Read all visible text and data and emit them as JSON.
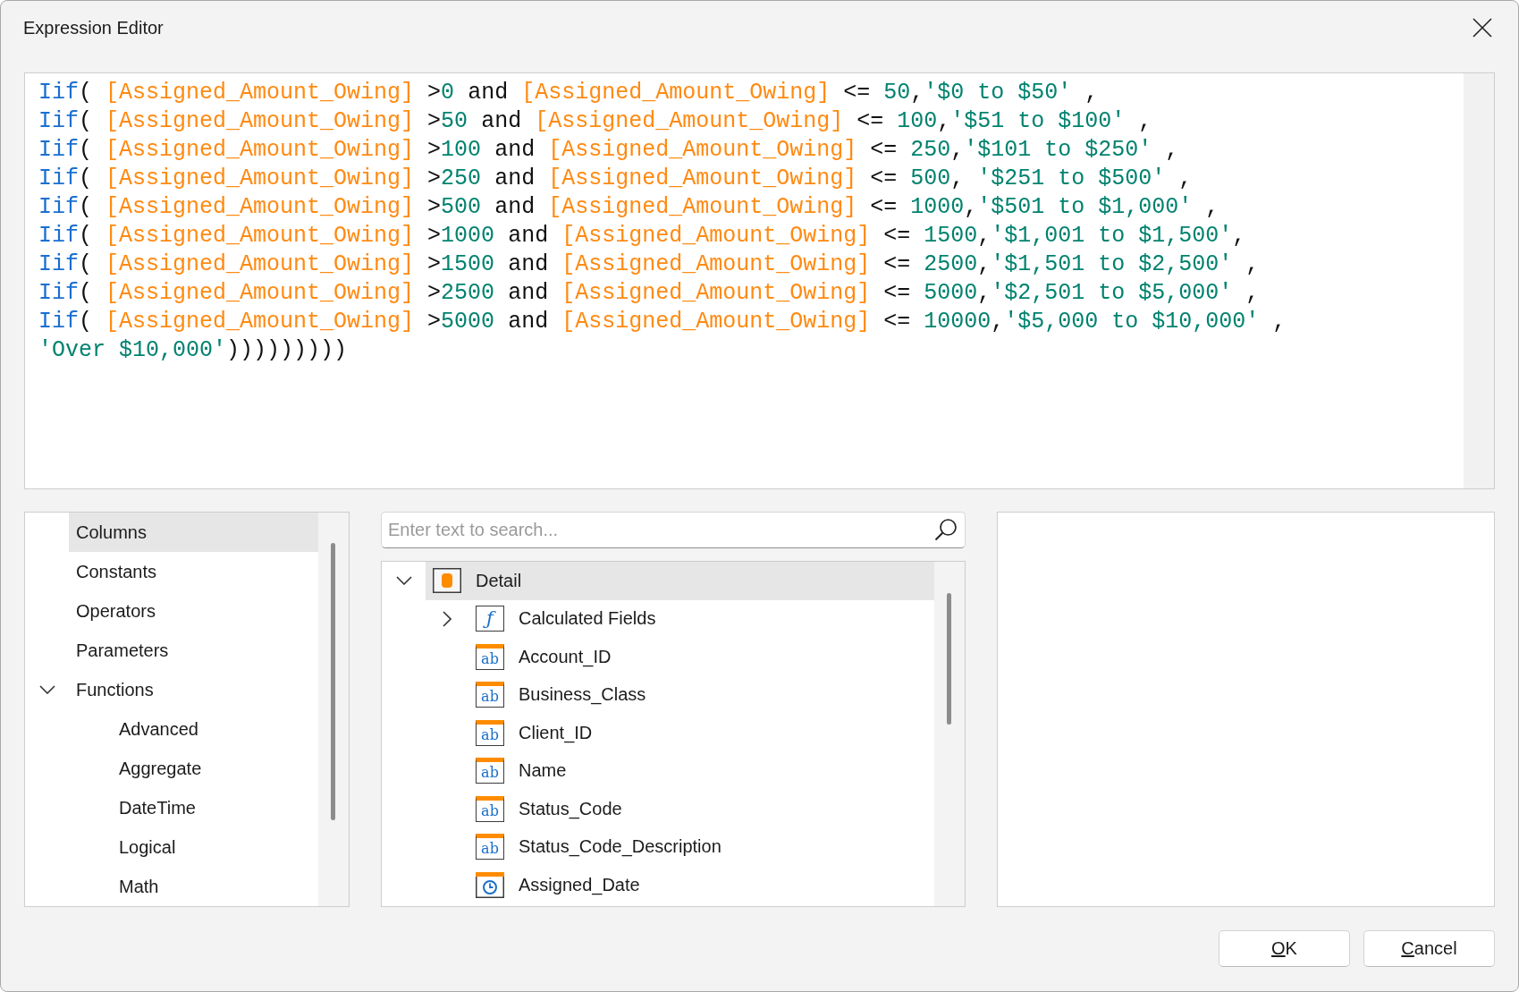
{
  "window": {
    "title": "Expression Editor"
  },
  "expression": {
    "lines": [
      {
        "tokens": [
          {
            "kind": "function",
            "text": "Iif"
          },
          {
            "kind": "plain",
            "text": "( "
          },
          {
            "kind": "field",
            "text": "[Assigned_Amount_Owing]"
          },
          {
            "kind": "plain",
            "text": " >"
          },
          {
            "kind": "number",
            "text": "0"
          },
          {
            "kind": "plain",
            "text": " and "
          },
          {
            "kind": "field",
            "text": "[Assigned_Amount_Owing]"
          },
          {
            "kind": "plain",
            "text": " <= "
          },
          {
            "kind": "number",
            "text": "50"
          },
          {
            "kind": "plain",
            "text": ","
          },
          {
            "kind": "string",
            "text": "'$0 to $50'"
          },
          {
            "kind": "plain",
            "text": " ,"
          }
        ]
      },
      {
        "tokens": [
          {
            "kind": "function",
            "text": "Iif"
          },
          {
            "kind": "plain",
            "text": "( "
          },
          {
            "kind": "field",
            "text": "[Assigned_Amount_Owing]"
          },
          {
            "kind": "plain",
            "text": " >"
          },
          {
            "kind": "number",
            "text": "50"
          },
          {
            "kind": "plain",
            "text": " and "
          },
          {
            "kind": "field",
            "text": "[Assigned_Amount_Owing]"
          },
          {
            "kind": "plain",
            "text": " <= "
          },
          {
            "kind": "number",
            "text": "100"
          },
          {
            "kind": "plain",
            "text": ","
          },
          {
            "kind": "string",
            "text": "'$51 to $100'"
          },
          {
            "kind": "plain",
            "text": " ,"
          }
        ]
      },
      {
        "tokens": [
          {
            "kind": "function",
            "text": "Iif"
          },
          {
            "kind": "plain",
            "text": "( "
          },
          {
            "kind": "field",
            "text": "[Assigned_Amount_Owing]"
          },
          {
            "kind": "plain",
            "text": " >"
          },
          {
            "kind": "number",
            "text": "100"
          },
          {
            "kind": "plain",
            "text": " and "
          },
          {
            "kind": "field",
            "text": "[Assigned_Amount_Owing]"
          },
          {
            "kind": "plain",
            "text": " <= "
          },
          {
            "kind": "number",
            "text": "250"
          },
          {
            "kind": "plain",
            "text": ","
          },
          {
            "kind": "string",
            "text": "'$101 to $250'"
          },
          {
            "kind": "plain",
            "text": " ,"
          }
        ]
      },
      {
        "tokens": [
          {
            "kind": "function",
            "text": "Iif"
          },
          {
            "kind": "plain",
            "text": "( "
          },
          {
            "kind": "field",
            "text": "[Assigned_Amount_Owing]"
          },
          {
            "kind": "plain",
            "text": " >"
          },
          {
            "kind": "number",
            "text": "250"
          },
          {
            "kind": "plain",
            "text": " and "
          },
          {
            "kind": "field",
            "text": "[Assigned_Amount_Owing]"
          },
          {
            "kind": "plain",
            "text": " <= "
          },
          {
            "kind": "number",
            "text": "500"
          },
          {
            "kind": "plain",
            "text": ", "
          },
          {
            "kind": "string",
            "text": "'$251 to $500'"
          },
          {
            "kind": "plain",
            "text": " ,"
          }
        ]
      },
      {
        "tokens": [
          {
            "kind": "function",
            "text": "Iif"
          },
          {
            "kind": "plain",
            "text": "( "
          },
          {
            "kind": "field",
            "text": "[Assigned_Amount_Owing]"
          },
          {
            "kind": "plain",
            "text": " >"
          },
          {
            "kind": "number",
            "text": "500"
          },
          {
            "kind": "plain",
            "text": " and "
          },
          {
            "kind": "field",
            "text": "[Assigned_Amount_Owing]"
          },
          {
            "kind": "plain",
            "text": " <= "
          },
          {
            "kind": "number",
            "text": "1000"
          },
          {
            "kind": "plain",
            "text": ","
          },
          {
            "kind": "string",
            "text": "'$501 to $1,000'"
          },
          {
            "kind": "plain",
            "text": " ,"
          }
        ]
      },
      {
        "tokens": [
          {
            "kind": "function",
            "text": "Iif"
          },
          {
            "kind": "plain",
            "text": "( "
          },
          {
            "kind": "field",
            "text": "[Assigned_Amount_Owing]"
          },
          {
            "kind": "plain",
            "text": " >"
          },
          {
            "kind": "number",
            "text": "1000"
          },
          {
            "kind": "plain",
            "text": " and "
          },
          {
            "kind": "field",
            "text": "[Assigned_Amount_Owing]"
          },
          {
            "kind": "plain",
            "text": " <= "
          },
          {
            "kind": "number",
            "text": "1500"
          },
          {
            "kind": "plain",
            "text": ","
          },
          {
            "kind": "string",
            "text": "'$1,001 to $1,500'"
          },
          {
            "kind": "plain",
            "text": ","
          }
        ]
      },
      {
        "tokens": [
          {
            "kind": "function",
            "text": "Iif"
          },
          {
            "kind": "plain",
            "text": "( "
          },
          {
            "kind": "field",
            "text": "[Assigned_Amount_Owing]"
          },
          {
            "kind": "plain",
            "text": " >"
          },
          {
            "kind": "number",
            "text": "1500"
          },
          {
            "kind": "plain",
            "text": " and "
          },
          {
            "kind": "field",
            "text": "[Assigned_Amount_Owing]"
          },
          {
            "kind": "plain",
            "text": " <= "
          },
          {
            "kind": "number",
            "text": "2500"
          },
          {
            "kind": "plain",
            "text": ","
          },
          {
            "kind": "string",
            "text": "'$1,501 to $2,500'"
          },
          {
            "kind": "plain",
            "text": " ,"
          }
        ]
      },
      {
        "tokens": [
          {
            "kind": "function",
            "text": "Iif"
          },
          {
            "kind": "plain",
            "text": "( "
          },
          {
            "kind": "field",
            "text": "[Assigned_Amount_Owing]"
          },
          {
            "kind": "plain",
            "text": " >"
          },
          {
            "kind": "number",
            "text": "2500"
          },
          {
            "kind": "plain",
            "text": " and "
          },
          {
            "kind": "field",
            "text": "[Assigned_Amount_Owing]"
          },
          {
            "kind": "plain",
            "text": " <= "
          },
          {
            "kind": "number",
            "text": "5000"
          },
          {
            "kind": "plain",
            "text": ","
          },
          {
            "kind": "string",
            "text": "'$2,501 to $5,000'"
          },
          {
            "kind": "plain",
            "text": " ,"
          }
        ]
      },
      {
        "tokens": [
          {
            "kind": "function",
            "text": "Iif"
          },
          {
            "kind": "plain",
            "text": "( "
          },
          {
            "kind": "field",
            "text": "[Assigned_Amount_Owing]"
          },
          {
            "kind": "plain",
            "text": " >"
          },
          {
            "kind": "number",
            "text": "5000"
          },
          {
            "kind": "plain",
            "text": " and "
          },
          {
            "kind": "field",
            "text": "[Assigned_Amount_Owing]"
          },
          {
            "kind": "plain",
            "text": " <= "
          },
          {
            "kind": "number",
            "text": "10000"
          },
          {
            "kind": "plain",
            "text": ","
          },
          {
            "kind": "string",
            "text": "'$5,000 to $10,000'"
          },
          {
            "kind": "plain",
            "text": " ,"
          }
        ]
      },
      {
        "tokens": [
          {
            "kind": "string",
            "text": "'Over $10,000'"
          },
          {
            "kind": "plain",
            "text": ")))))))))"
          }
        ]
      }
    ]
  },
  "categories": {
    "items": [
      {
        "label": "Columns",
        "selected": true
      },
      {
        "label": "Constants",
        "selected": false
      },
      {
        "label": "Operators",
        "selected": false
      },
      {
        "label": "Parameters",
        "selected": false
      },
      {
        "label": "Functions",
        "selected": false,
        "expanded": true,
        "children": [
          {
            "label": "Advanced",
            "selected": false
          },
          {
            "label": "Aggregate",
            "selected": false
          },
          {
            "label": "DateTime",
            "selected": false
          },
          {
            "label": "Logical",
            "selected": false
          },
          {
            "label": "Math",
            "selected": false
          }
        ]
      }
    ]
  },
  "search": {
    "placeholder": "Enter text to search..."
  },
  "fields": {
    "items": [
      {
        "label": "Detail",
        "kind": "table",
        "selected": true,
        "expanded": true,
        "children": [
          {
            "label": "Calculated Fields",
            "kind": "function",
            "glyph": "ƒ",
            "selected": false,
            "expanded": false
          },
          {
            "label": "Account_ID",
            "kind": "text",
            "glyph": "ab",
            "selected": false
          },
          {
            "label": "Business_Class",
            "kind": "text",
            "glyph": "ab",
            "selected": false
          },
          {
            "label": "Client_ID",
            "kind": "text",
            "glyph": "ab",
            "selected": false
          },
          {
            "label": "Name",
            "kind": "text",
            "glyph": "ab",
            "selected": false
          },
          {
            "label": "Status_Code",
            "kind": "text",
            "glyph": "ab",
            "selected": false
          },
          {
            "label": "Status_Code_Description",
            "kind": "text",
            "glyph": "ab",
            "selected": false
          },
          {
            "label": "Assigned_Date",
            "kind": "date",
            "selected": false
          }
        ]
      }
    ]
  },
  "buttons": [
    {
      "label": "OK",
      "access_key_underlined": true
    },
    {
      "label": "Cancel",
      "access_key_underlined": true
    }
  ]
}
